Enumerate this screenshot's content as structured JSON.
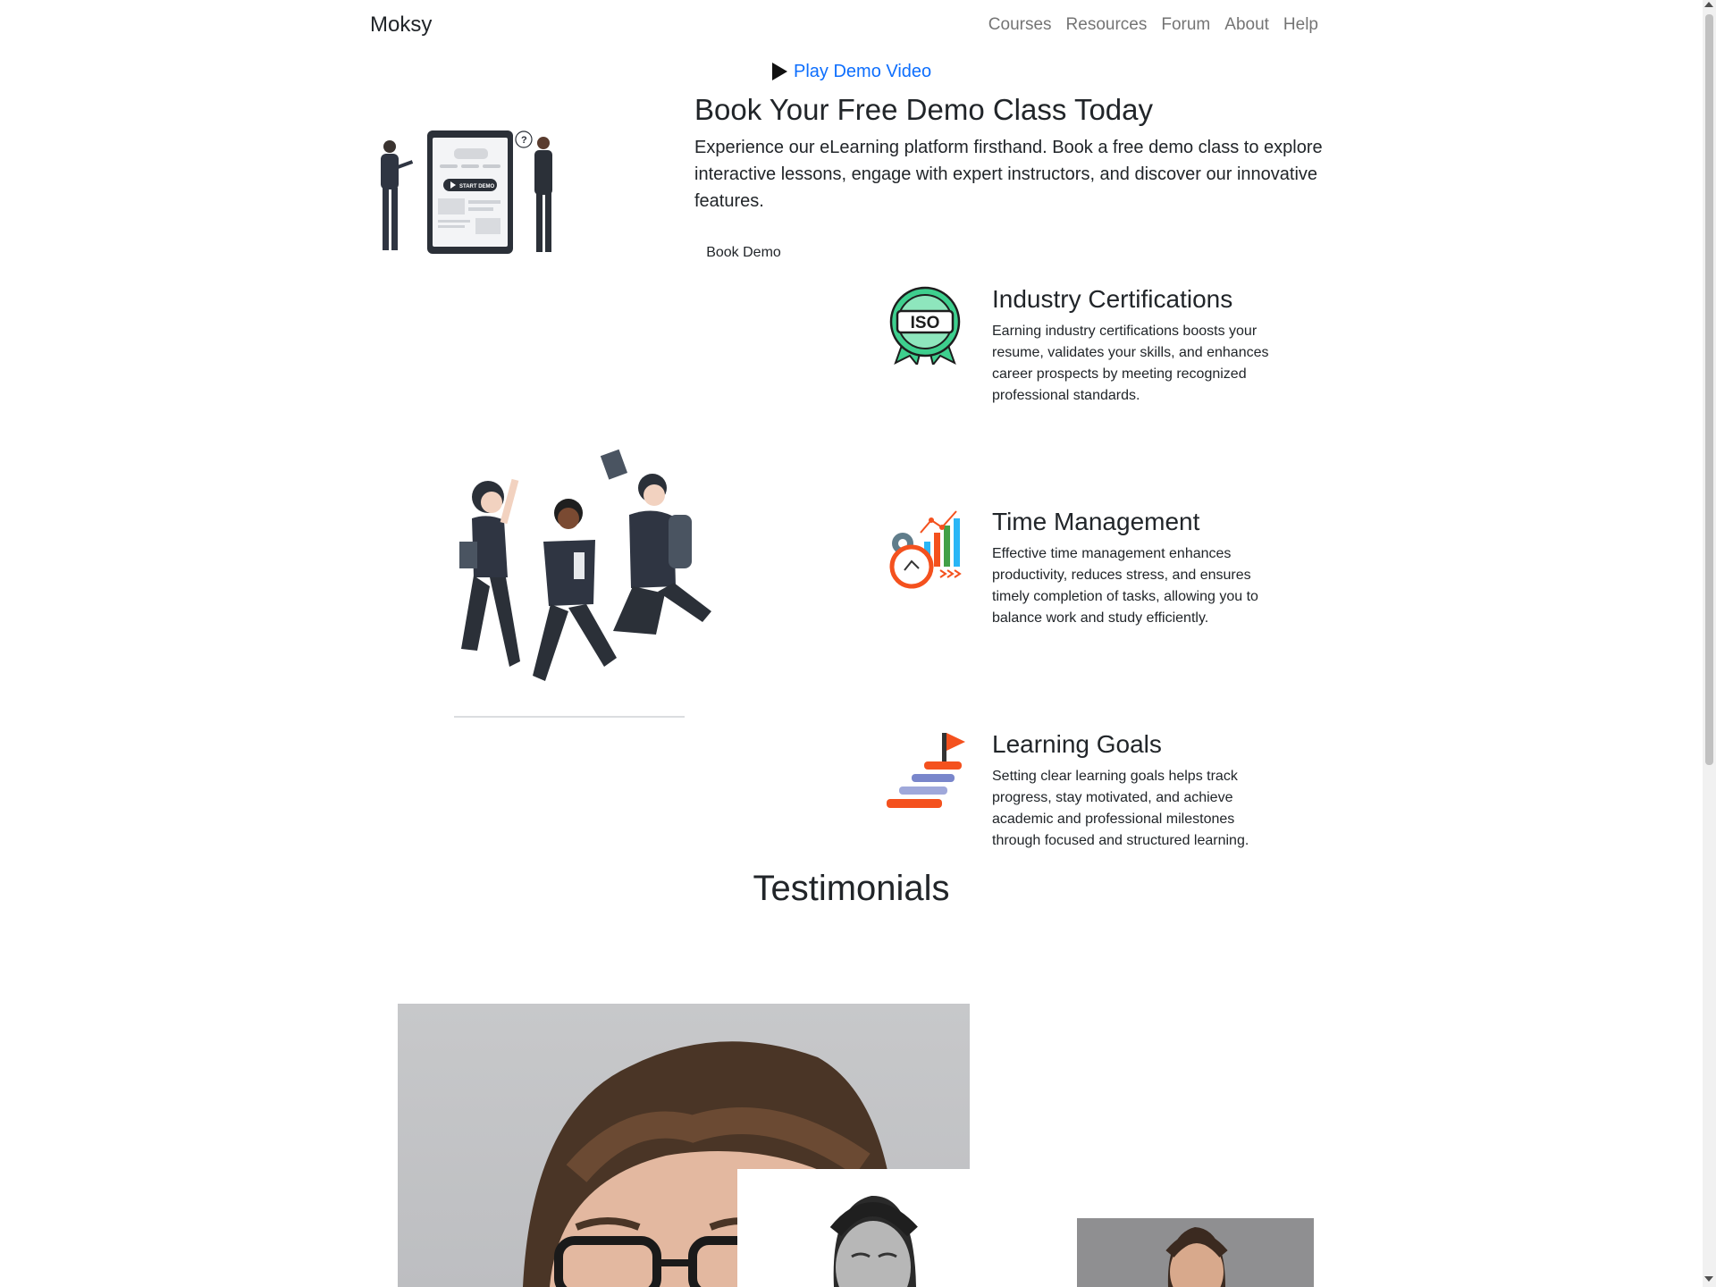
{
  "navbar": {
    "brand": "Moksy",
    "links": [
      "Courses",
      "Resources",
      "Forum",
      "About",
      "Help"
    ]
  },
  "hero": {
    "play_link": "Play Demo Video",
    "title": "Book Your Free Demo Class Today",
    "description": "Experience our eLearning platform firsthand. Book a free demo class to explore interactive lessons, engage with expert instructors, and discover our innovative features.",
    "button": "Book Demo",
    "illustration_label": "START DEMO"
  },
  "features": [
    {
      "title": "Industry Certifications",
      "text": "Earning industry certifications boosts your resume, validates your skills, and enhances career prospects by meeting recognized professional standards.",
      "badge": "ISO",
      "icon": "iso-certificate-icon"
    },
    {
      "title": "Time Management",
      "text": "Effective time management enhances productivity, reduces stress, and ensures timely completion of tasks, allowing you to balance work and study efficiently.",
      "icon": "time-management-icon"
    },
    {
      "title": "Learning Goals",
      "text": "Setting clear learning goals helps track progress, stay motivated, and achieve academic and professional milestones through focused and structured learning.",
      "icon": "learning-goals-icon"
    }
  ],
  "testimonials": {
    "heading": "Testimonials"
  },
  "colors": {
    "link": "#0d6efd",
    "nav_link": "#8c8c8c",
    "iso_green": "#3ecf8e",
    "time_orange": "#f4511e",
    "goal_blue": "#5b6fd6"
  }
}
